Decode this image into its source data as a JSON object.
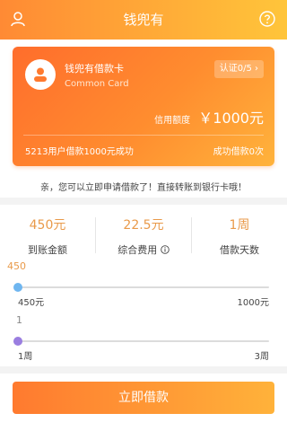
{
  "header": {
    "title": "钱兜有",
    "left_icon": "user-icon",
    "right_icon": "question-circle-icon"
  },
  "card": {
    "name": "钱兜有借款卡",
    "subtitle": "Common Card",
    "verify_label": "认证0/5",
    "verify_icon": "chevron-right-icon",
    "credit_label": "信用额度",
    "credit_amount": "￥1000元",
    "stat_left": "5213用户借款1000元成功",
    "stat_right": "成功借款0次"
  },
  "notice": "亲，您可以立即申请借款了！直接转账到银行卡哦！",
  "stats": [
    {
      "value": "450元",
      "label": "到账金额"
    },
    {
      "value": "22.5元",
      "label": "综合费用",
      "icon": "info-circle-icon"
    },
    {
      "value": "1周",
      "label": "借款天数"
    }
  ],
  "amount_slider": {
    "current": "450",
    "min_label": "450元",
    "max_label": "1000元",
    "level": 0,
    "color": "#6fb6f0"
  },
  "term_slider": {
    "current": "1",
    "min_label": "1周",
    "max_label": "3周",
    "level": 0,
    "color": "#9a7ee0"
  },
  "apply_button": "立即借款",
  "colors": {
    "accent_start": "#ff7a2f",
    "accent_end": "#ffb23a",
    "value_orange": "#e99a4a"
  }
}
